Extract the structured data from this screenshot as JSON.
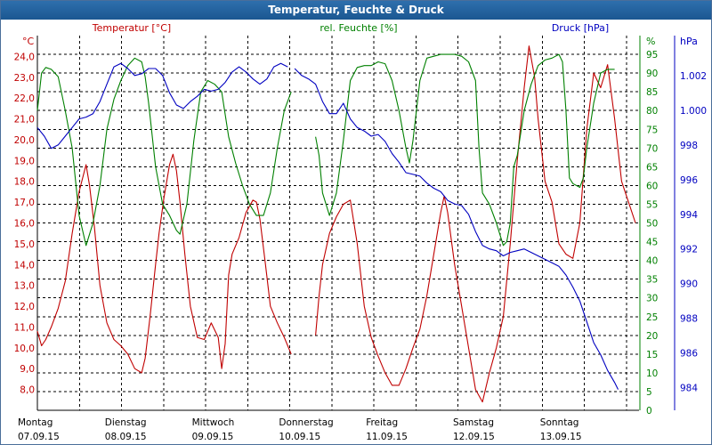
{
  "window": {
    "title": "Temperatur, Feuchte & Druck"
  },
  "colors": {
    "temperature": "#c00000",
    "humidity": "#008000",
    "pressure": "#0000c0",
    "grid": "#000000",
    "titlebar": "#1f5c97"
  },
  "chart_data": {
    "type": "line",
    "title": "Temperatur, Feuchte & Druck",
    "grid": true,
    "x": {
      "labels": [
        {
          "day": "Montag",
          "date": "07.09.15"
        },
        {
          "day": "Dienstag",
          "date": "08.09.15"
        },
        {
          "day": "Mittwoch",
          "date": "09.09.15"
        },
        {
          "day": "Donnerstag",
          "date": "10.09.15"
        },
        {
          "day": "Freitag",
          "date": "11.09.15"
        },
        {
          "day": "Samstag",
          "date": "12.09.15"
        },
        {
          "day": "Sonntag",
          "date": "13.09.15"
        }
      ],
      "range": [
        0,
        7.15
      ],
      "units": "days"
    },
    "axes": {
      "temperature": {
        "label": "Temperatur [°C]",
        "unit": "°C",
        "range": [
          7.0,
          25.0
        ],
        "ticks": [
          "24,0",
          "23,0",
          "22,0",
          "21,0",
          "20,0",
          "19,0",
          "18,0",
          "17,0",
          "16,0",
          "15,0",
          "14,0",
          "13,0",
          "12,0",
          "11,0",
          "10,0",
          "9,0",
          "8,0"
        ]
      },
      "humidity": {
        "label": "rel. Feuchte [%]",
        "unit": "%",
        "range": [
          0,
          100
        ],
        "ticks": [
          "95",
          "90",
          "85",
          "80",
          "75",
          "70",
          "65",
          "60",
          "55",
          "50",
          "45",
          "40",
          "35",
          "30",
          "25",
          "20",
          "15",
          "10",
          "5",
          "0"
        ]
      },
      "pressure": {
        "label": "Druck [hPa]",
        "unit": "hPa",
        "range": [
          982.7,
          1004.3
        ],
        "ticks": [
          "1.002",
          "1.000",
          "998",
          "996",
          "994",
          "992",
          "990",
          "988",
          "986",
          "984"
        ]
      }
    },
    "series": [
      {
        "name": "Temperatur [°C]",
        "axis": "temperature",
        "points": [
          [
            0.0,
            10.8
          ],
          [
            0.06,
            10.1
          ],
          [
            0.12,
            10.4
          ],
          [
            0.2,
            11.0
          ],
          [
            0.3,
            11.9
          ],
          [
            0.4,
            13.2
          ],
          [
            0.5,
            15.5
          ],
          [
            0.6,
            17.5
          ],
          [
            0.7,
            18.8
          ],
          [
            0.75,
            17.8
          ],
          [
            0.82,
            15.8
          ],
          [
            0.9,
            13.0
          ],
          [
            1.0,
            11.2
          ],
          [
            1.1,
            10.4
          ],
          [
            1.2,
            10.1
          ],
          [
            1.3,
            9.7
          ],
          [
            1.4,
            9.0
          ],
          [
            1.5,
            8.8
          ],
          [
            1.55,
            9.5
          ],
          [
            1.62,
            11.5
          ],
          [
            1.7,
            14.0
          ],
          [
            1.75,
            15.5
          ],
          [
            1.82,
            17.2
          ],
          [
            1.9,
            18.8
          ],
          [
            1.95,
            19.3
          ],
          [
            2.0,
            18.5
          ],
          [
            2.05,
            17.0
          ],
          [
            2.12,
            14.5
          ],
          [
            2.2,
            12.0
          ],
          [
            2.3,
            10.5
          ],
          [
            2.4,
            10.4
          ],
          [
            2.5,
            11.2
          ],
          [
            2.6,
            10.5
          ],
          [
            2.65,
            9.0
          ],
          [
            2.7,
            10.2
          ],
          [
            2.75,
            13.5
          ],
          [
            2.8,
            14.5
          ],
          [
            2.9,
            15.3
          ],
          [
            3.0,
            16.5
          ],
          [
            3.1,
            17.1
          ],
          [
            3.15,
            17.0
          ],
          [
            3.2,
            16.2
          ],
          [
            3.28,
            14.0
          ],
          [
            3.35,
            12.0
          ],
          [
            3.45,
            11.2
          ],
          [
            3.55,
            10.5
          ],
          [
            3.65,
            9.7
          ],
          null,
          [
            4.0,
            10.6
          ],
          [
            4.05,
            12.5
          ],
          [
            4.1,
            14.0
          ],
          [
            4.2,
            15.5
          ],
          [
            4.3,
            16.3
          ],
          [
            4.4,
            16.9
          ],
          [
            4.5,
            17.1
          ],
          [
            4.6,
            15.0
          ],
          [
            4.7,
            12.0
          ],
          [
            4.8,
            10.5
          ],
          [
            4.9,
            9.6
          ],
          [
            5.0,
            8.8
          ],
          [
            5.1,
            8.2
          ],
          [
            5.2,
            8.2
          ],
          [
            5.3,
            9.0
          ],
          [
            5.4,
            10.0
          ],
          [
            5.5,
            10.9
          ],
          [
            5.6,
            12.5
          ],
          [
            5.7,
            14.5
          ],
          [
            5.8,
            16.5
          ],
          [
            5.85,
            17.3
          ],
          [
            5.9,
            16.5
          ],
          [
            6.0,
            14.0
          ],
          [
            6.1,
            12.0
          ],
          [
            6.2,
            10.0
          ],
          [
            6.3,
            8.0
          ],
          [
            6.4,
            7.4
          ],
          [
            6.5,
            8.8
          ],
          [
            6.6,
            10.0
          ],
          [
            6.7,
            11.5
          ],
          [
            6.8,
            15.0
          ],
          [
            6.9,
            19.0
          ],
          [
            7.0,
            22.5
          ],
          [
            7.07,
            24.5
          ],
          [
            7.15,
            23.0
          ],
          [
            7.2,
            21.0
          ],
          [
            7.3,
            18.0
          ],
          [
            7.4,
            17.0
          ],
          [
            7.5,
            15.0
          ],
          [
            7.6,
            14.5
          ],
          [
            7.7,
            14.3
          ],
          [
            7.8,
            16.0
          ],
          [
            7.9,
            20.5
          ],
          [
            8.0,
            23.2
          ],
          [
            8.1,
            22.5
          ],
          [
            8.2,
            23.6
          ],
          [
            8.3,
            21.0
          ],
          [
            8.4,
            18.0
          ],
          [
            8.5,
            17.0
          ],
          [
            8.6,
            16.0
          ]
        ]
      },
      {
        "name": "rel. Feuchte [%]",
        "axis": "humidity",
        "points": [
          [
            0.0,
            80.0
          ],
          [
            0.06,
            90.0
          ],
          [
            0.12,
            91.5
          ],
          [
            0.2,
            91.0
          ],
          [
            0.3,
            89.0
          ],
          [
            0.4,
            80.0
          ],
          [
            0.5,
            70.0
          ],
          [
            0.6,
            52.0
          ],
          [
            0.7,
            44.0
          ],
          [
            0.8,
            50.0
          ],
          [
            0.9,
            60.0
          ],
          [
            1.0,
            75.0
          ],
          [
            1.1,
            83.0
          ],
          [
            1.2,
            88.0
          ],
          [
            1.3,
            92.0
          ],
          [
            1.4,
            94.0
          ],
          [
            1.5,
            93.0
          ],
          [
            1.55,
            89.0
          ],
          [
            1.6,
            82.0
          ],
          [
            1.7,
            65.0
          ],
          [
            1.8,
            55.0
          ],
          [
            1.9,
            52.0
          ],
          [
            2.0,
            48.0
          ],
          [
            2.05,
            47.0
          ],
          [
            2.15,
            55.0
          ],
          [
            2.25,
            72.0
          ],
          [
            2.35,
            85.0
          ],
          [
            2.45,
            88.0
          ],
          [
            2.55,
            87.0
          ],
          [
            2.65,
            85.0
          ],
          [
            2.75,
            73.0
          ],
          [
            2.85,
            66.0
          ],
          [
            2.95,
            60.0
          ],
          [
            3.05,
            55.0
          ],
          [
            3.15,
            52.0
          ],
          [
            3.25,
            52.0
          ],
          [
            3.35,
            58.0
          ],
          [
            3.45,
            70.0
          ],
          [
            3.55,
            80.0
          ],
          [
            3.65,
            85.0
          ],
          null,
          [
            4.0,
            73.0
          ],
          [
            4.05,
            68.0
          ],
          [
            4.1,
            58.0
          ],
          [
            4.2,
            52.0
          ],
          [
            4.3,
            58.0
          ],
          [
            4.4,
            72.0
          ],
          [
            4.5,
            88.0
          ],
          [
            4.6,
            91.5
          ],
          [
            4.7,
            92.0
          ],
          [
            4.8,
            92.0
          ],
          [
            4.9,
            93.0
          ],
          [
            5.0,
            92.5
          ],
          [
            5.1,
            88.0
          ],
          [
            5.2,
            80.0
          ],
          [
            5.3,
            70.0
          ],
          [
            5.35,
            66.0
          ],
          [
            5.4,
            72.0
          ],
          [
            5.5,
            88.0
          ],
          [
            5.6,
            94.0
          ],
          [
            5.7,
            94.5
          ],
          [
            5.8,
            95.0
          ],
          [
            5.9,
            95.0
          ],
          [
            6.0,
            95.0
          ],
          [
            6.1,
            94.5
          ],
          [
            6.2,
            93.0
          ],
          [
            6.3,
            88.0
          ],
          [
            6.35,
            70.0
          ],
          [
            6.4,
            58.0
          ],
          [
            6.5,
            55.0
          ],
          [
            6.6,
            50.0
          ],
          [
            6.7,
            44.0
          ],
          [
            6.75,
            45.0
          ],
          [
            6.8,
            50.0
          ],
          [
            6.85,
            65.0
          ],
          [
            6.9,
            68.0
          ],
          [
            7.0,
            80.0
          ],
          [
            7.1,
            87.0
          ],
          [
            7.2,
            92.0
          ],
          [
            7.3,
            93.5
          ],
          [
            7.4,
            94.0
          ],
          [
            7.5,
            95.0
          ],
          [
            7.55,
            93.0
          ],
          [
            7.6,
            80.0
          ],
          [
            7.65,
            62.0
          ],
          [
            7.7,
            60.5
          ],
          [
            7.8,
            59.5
          ],
          [
            7.85,
            62.0
          ],
          [
            7.9,
            70.0
          ],
          [
            8.0,
            82.0
          ],
          [
            8.1,
            90.0
          ],
          [
            8.2,
            91.0
          ],
          [
            8.3,
            91.0
          ]
        ]
      },
      {
        "name": "Druck [hPa]",
        "axis": "pressure",
        "points": [
          [
            0.0,
            999.0
          ],
          [
            0.1,
            998.5
          ],
          [
            0.2,
            997.8
          ],
          [
            0.3,
            998.0
          ],
          [
            0.4,
            998.5
          ],
          [
            0.5,
            999.0
          ],
          [
            0.6,
            999.5
          ],
          [
            0.7,
            999.6
          ],
          [
            0.8,
            999.8
          ],
          [
            0.9,
            1000.5
          ],
          [
            1.0,
            1001.5
          ],
          [
            1.1,
            1002.5
          ],
          [
            1.2,
            1002.7
          ],
          [
            1.3,
            1002.4
          ],
          [
            1.4,
            1002.0
          ],
          [
            1.5,
            1002.1
          ],
          [
            1.6,
            1002.4
          ],
          [
            1.7,
            1002.4
          ],
          [
            1.8,
            1002.0
          ],
          [
            1.9,
            1001.0
          ],
          [
            2.0,
            1000.3
          ],
          [
            2.1,
            1000.1
          ],
          [
            2.2,
            1000.5
          ],
          [
            2.3,
            1000.8
          ],
          [
            2.4,
            1001.2
          ],
          [
            2.5,
            1001.1
          ],
          [
            2.6,
            1001.2
          ],
          [
            2.7,
            1001.6
          ],
          [
            2.8,
            1002.2
          ],
          [
            2.9,
            1002.5
          ],
          [
            3.0,
            1002.2
          ],
          [
            3.1,
            1001.8
          ],
          [
            3.2,
            1001.5
          ],
          [
            3.3,
            1001.8
          ],
          [
            3.4,
            1002.5
          ],
          [
            3.5,
            1002.7
          ],
          [
            3.6,
            1002.5
          ],
          null,
          [
            3.7,
            1002.4
          ],
          [
            3.8,
            1002.0
          ],
          [
            3.9,
            1001.8
          ],
          [
            4.0,
            1001.5
          ],
          [
            4.1,
            1000.5
          ],
          [
            4.2,
            999.8
          ],
          [
            4.3,
            999.8
          ],
          [
            4.4,
            1000.4
          ],
          [
            4.5,
            999.5
          ],
          [
            4.6,
            999.0
          ],
          [
            4.7,
            998.8
          ],
          [
            4.8,
            998.5
          ],
          [
            4.9,
            998.6
          ],
          [
            5.0,
            998.2
          ],
          [
            5.1,
            997.5
          ],
          [
            5.2,
            997.0
          ],
          [
            5.3,
            996.4
          ],
          [
            5.4,
            996.3
          ],
          [
            5.5,
            996.2
          ],
          [
            5.6,
            995.8
          ],
          [
            5.7,
            995.5
          ],
          [
            5.8,
            995.3
          ],
          [
            5.9,
            994.8
          ],
          [
            6.0,
            994.6
          ],
          [
            6.1,
            994.5
          ],
          [
            6.2,
            994.0
          ],
          [
            6.3,
            993.0
          ],
          [
            6.4,
            992.2
          ],
          [
            6.5,
            992.0
          ],
          [
            6.6,
            991.9
          ],
          [
            6.7,
            991.6
          ],
          [
            6.8,
            991.8
          ],
          [
            6.9,
            991.9
          ],
          [
            7.0,
            992.0
          ],
          [
            7.1,
            991.8
          ],
          [
            7.2,
            991.6
          ],
          [
            7.3,
            991.4
          ],
          [
            7.4,
            991.2
          ],
          [
            7.5,
            991.0
          ],
          [
            7.6,
            990.5
          ],
          [
            7.7,
            989.8
          ],
          [
            7.8,
            989.0
          ],
          [
            7.9,
            987.8
          ],
          [
            8.0,
            986.6
          ],
          [
            8.1,
            985.9
          ],
          [
            8.2,
            985.0
          ],
          [
            8.3,
            984.3
          ],
          [
            8.35,
            983.9
          ]
        ]
      }
    ]
  }
}
